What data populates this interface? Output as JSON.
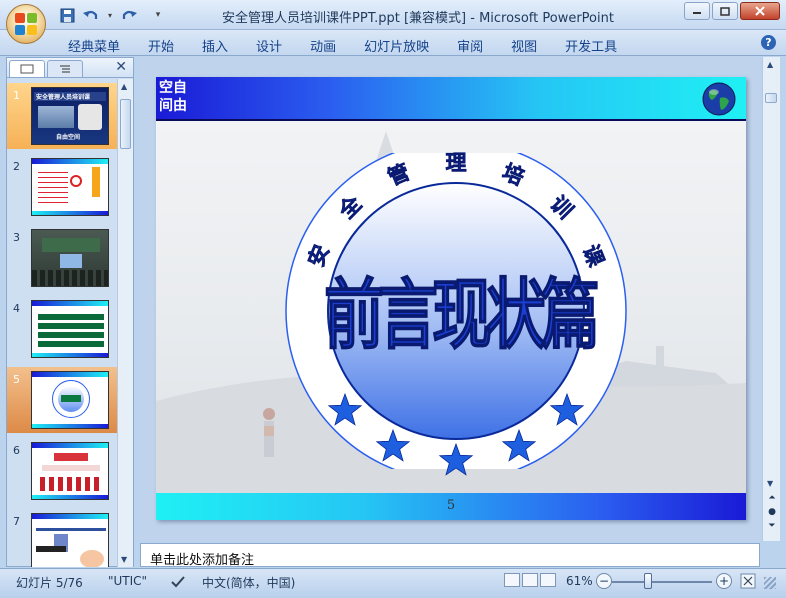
{
  "window": {
    "title": "安全管理人员培训课件PPT.ppt [兼容模式] - Microsoft PowerPoint",
    "minimize_icon": "minimize-icon",
    "maximize_icon": "maximize-icon",
    "close_icon": "close-icon"
  },
  "quick_access": [
    "save-icon",
    "undo-icon",
    "redo-icon",
    "customize-qat-icon"
  ],
  "ribbon": {
    "tabs": [
      "经典菜单",
      "开始",
      "插入",
      "设计",
      "动画",
      "幻灯片放映",
      "审阅",
      "视图",
      "开发工具"
    ],
    "help_label": "?"
  },
  "thumbnail_pane": {
    "close_label": "✕",
    "slides": [
      {
        "num": "1",
        "label": "安全管理人员培训课",
        "sub": "自由空间",
        "state": "selected"
      },
      {
        "num": "2",
        "label": "",
        "sub": "",
        "state": ""
      },
      {
        "num": "3",
        "label": "",
        "sub": "",
        "state": ""
      },
      {
        "num": "4",
        "label": "",
        "sub": "",
        "state": ""
      },
      {
        "num": "5",
        "label": "",
        "sub": "",
        "state": "current"
      },
      {
        "num": "6",
        "label": "",
        "sub": "",
        "state": ""
      },
      {
        "num": "7",
        "label": "",
        "sub": "",
        "state": ""
      }
    ]
  },
  "slide": {
    "logo_text": "空自间由",
    "arc_text": [
      "安",
      "全",
      "管",
      "理",
      "培",
      "训",
      "课"
    ],
    "main_title": "前言现状篇",
    "page_number": "5",
    "colors": {
      "header_dark": "#1a1ad6",
      "header_light": "#1ff0f4",
      "star": "#1e5fe0"
    }
  },
  "notes": {
    "placeholder": "单击此处添加备注"
  },
  "status": {
    "slide_info": "幻灯片 5/76",
    "theme": "\"UTIC\"",
    "language": "中文(简体，中国)",
    "zoom": "61%",
    "zoom_minus": "−",
    "zoom_plus": "+"
  }
}
